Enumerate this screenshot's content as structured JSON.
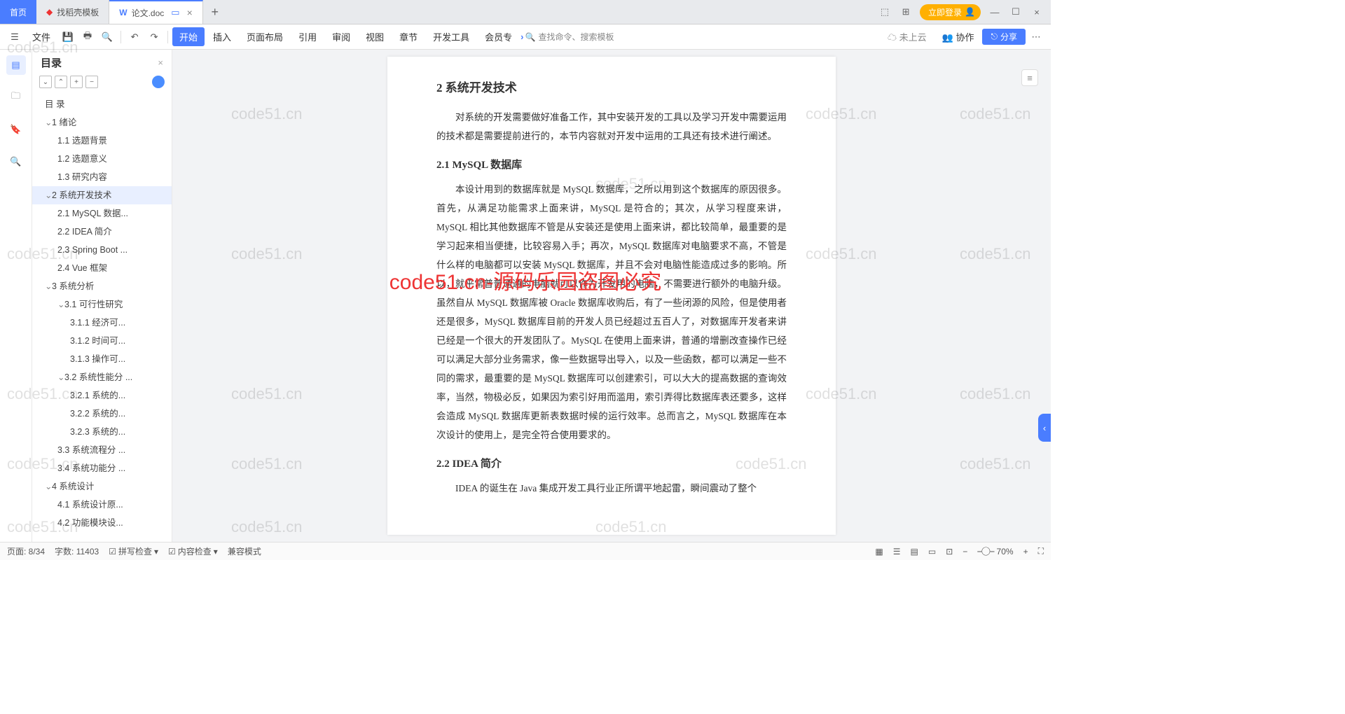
{
  "tabs": {
    "home": "首页",
    "t1": "找稻壳模板",
    "t2": "论文.doc"
  },
  "login_btn": "立即登录",
  "menu": {
    "file": "文件",
    "items": [
      "开始",
      "插入",
      "页面布局",
      "引用",
      "审阅",
      "视图",
      "章节",
      "开发工具",
      "会员专"
    ],
    "search": "查找命令、搜索模板",
    "cloud": "未上云",
    "coop": "协作",
    "share": "分享"
  },
  "outline": {
    "title": "目录",
    "root": "目 录",
    "n1": "1 绪论",
    "n1_1": "1.1 选题背景",
    "n1_2": "1.2 选题意义",
    "n1_3": "1.3 研究内容",
    "n2": "2 系统开发技术",
    "n2_1": "2.1 MySQL 数据...",
    "n2_2": "2.2 IDEA 简介",
    "n2_3": "2.3 Spring Boot ...",
    "n2_4": "2.4 Vue 框架",
    "n3": "3 系统分析",
    "n3_1": "3.1 可行性研究",
    "n3_1_1": "3.1.1 经济可...",
    "n3_1_2": "3.1.2 时间可...",
    "n3_1_3": "3.1.3 操作可...",
    "n3_2": "3.2 系统性能分 ...",
    "n3_2_1": "3.2.1 系统的...",
    "n3_2_2": "3.2.2 系统的...",
    "n3_2_3": "3.2.3 系统的...",
    "n3_3": "3.3 系统流程分 ...",
    "n3_4": "3.4 系统功能分 ...",
    "n4": "4 系统设计",
    "n4_1": "4.1 系统设计原...",
    "n4_2": "4.2 功能模块设..."
  },
  "doc": {
    "h2": "2 系统开发技术",
    "p0": "对系统的开发需要做好准备工作，其中安装开发的工具以及学习开发中需要运用的技术都是需要提前进行的，本节内容就对开发中运用的工具还有技术进行阐述。",
    "h2_1": "2.1 MySQL 数据库",
    "p1": "本设计用到的数据库就是 MySQL 数据库，之所以用到这个数据库的原因很多。首先，从满足功能需求上面来讲，MySQL 是符合的；其次，从学习程度来讲，MySQL 相比其他数据库不管是从安装还是使用上面来讲，都比较简单，最重要的是学习起来相当便捷，比较容易入手；再次，MySQL 数据库对电脑要求不高，不管是什么样的电脑都可以安装 MySQL 数据库，并且不会对电脑性能造成过多的影响。所以，就平常普普通通的电脑就可以作为开发用的电脑，不需要进行额外的电脑升级。虽然自从 MySQL 数据库被 Oracle 数据库收购后，有了一些闭源的风险，但是使用者还是很多，MySQL 数据库目前的开发人员已经超过五百人了，对数据库开发者来讲已经是一个很大的开发团队了。MySQL 在使用上面来讲，普通的增删改查操作已经可以满足大部分业务需求，像一些数据导出导入，以及一些函数，都可以满足一些不同的需求，最重要的是 MySQL 数据库可以创建索引，可以大大的提高数据的查询效率，当然，物极必反，如果因为索引好用而滥用，索引弄得比数据库表还要多，这样会造成 MySQL 数据库更新表数据时候的运行效率。总而言之，MySQL 数据库在本次设计的使用上，是完全符合使用要求的。",
    "h2_2": "2.2 IDEA 简介",
    "p2": "IDEA 的诞生在 Java 集成开发工具行业正所谓平地起雷，瞬间震动了整个"
  },
  "status": {
    "page": "页面: 8/34",
    "words": "字数: 11403",
    "spell": "拼写检查",
    "content": "内容检查",
    "compat": "兼容模式",
    "zoom": "70%"
  },
  "watermark": "code51.cn",
  "watermark_red": "code51.cn-源码乐园盗图必究"
}
